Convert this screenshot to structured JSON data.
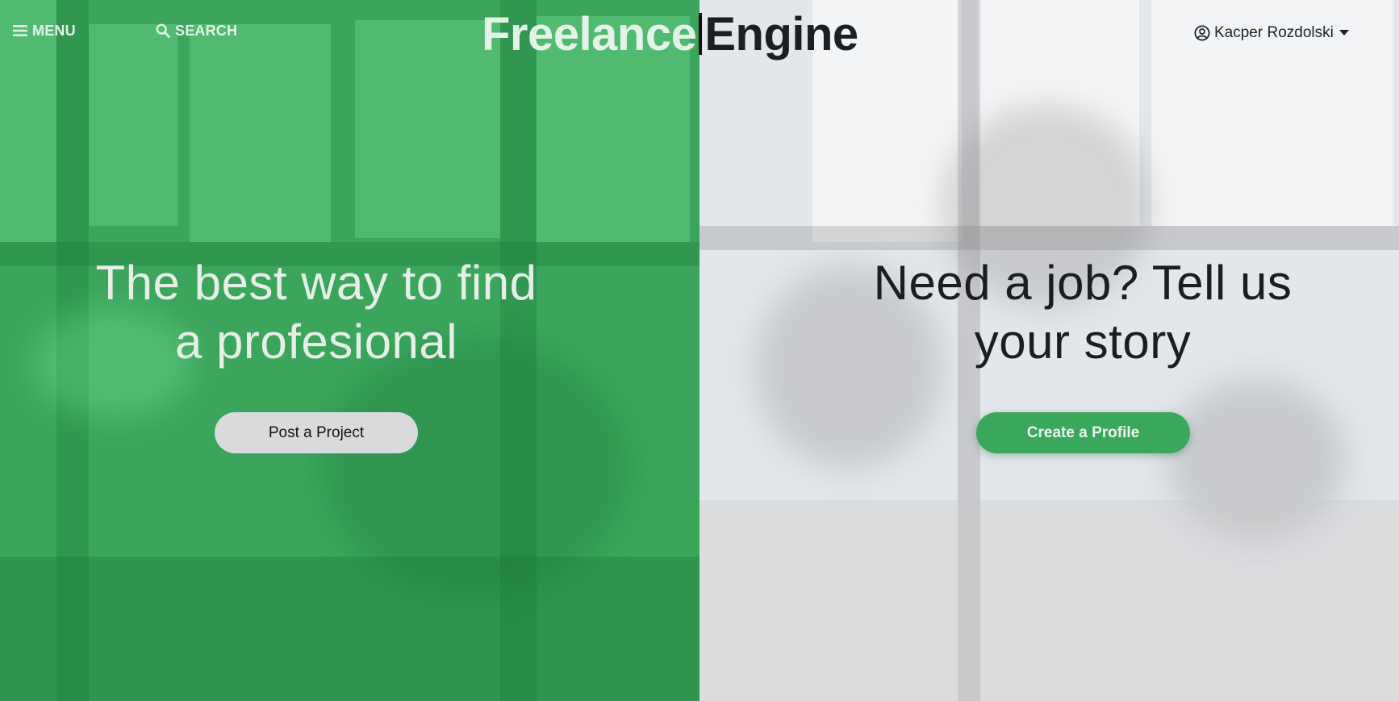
{
  "header": {
    "menu_label": "MENU",
    "search_label": "SEARCH",
    "logo_part1": "Freelance",
    "logo_part2": "Engine",
    "user_name": "Kacper Rozdolski",
    "icons": {
      "menu": "hamburger-icon",
      "search": "search-icon",
      "user": "user-circle-icon",
      "dropdown": "caret-down-icon"
    }
  },
  "left_panel": {
    "headline_line1": "The best way to find",
    "headline_line2": "a profesional",
    "button_label": "Post a Project",
    "tint_color": "#3ba55c"
  },
  "right_panel": {
    "headline_line1": "Need a job? Tell us",
    "headline_line2": "your story",
    "button_label": "Create a Profile",
    "tint_color": "#e3e6ea",
    "button_color": "#3aa85c"
  }
}
